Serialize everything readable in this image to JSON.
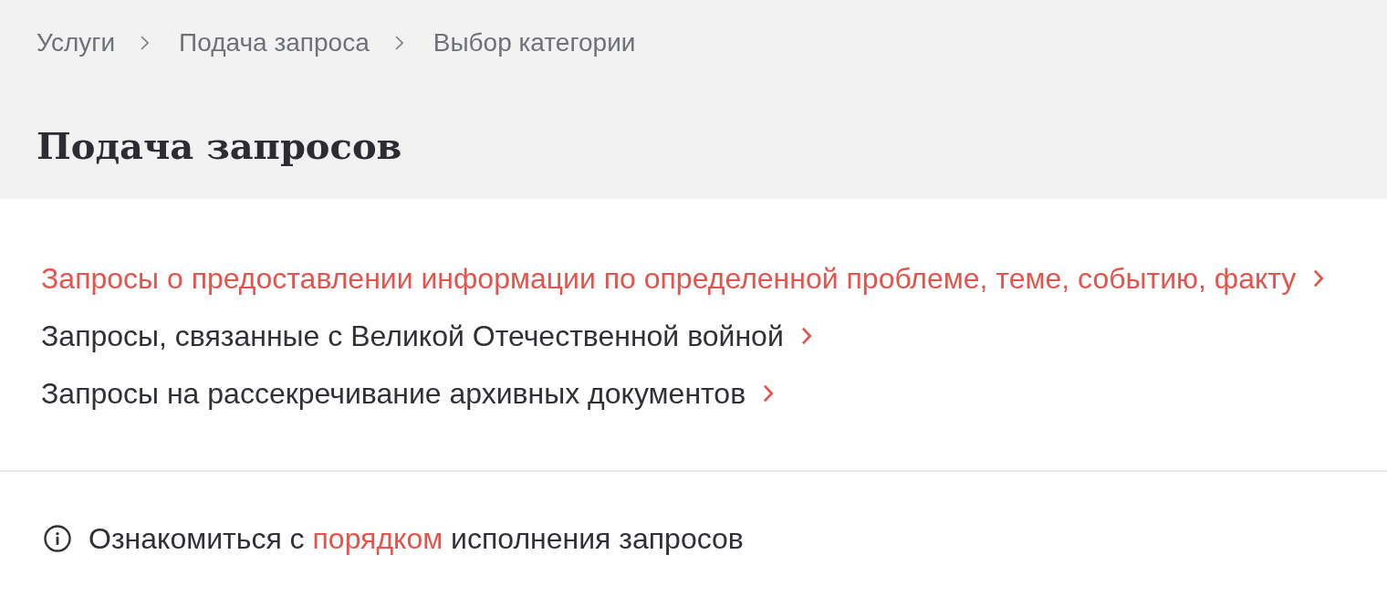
{
  "breadcrumbs": [
    {
      "label": "Услуги"
    },
    {
      "label": "Подача запроса"
    },
    {
      "label": "Выбор категории"
    }
  ],
  "title": "Подача запросов",
  "categories": [
    {
      "label": "Запросы о предоставлении информации по определенной проблеме, теме, событию, факту",
      "highlighted": true
    },
    {
      "label": "Запросы, связанные с Великой Отечественной войной",
      "highlighted": false
    },
    {
      "label": "Запросы на рассекречивание архивных документов",
      "highlighted": false
    }
  ],
  "info": {
    "text_before": "Ознакомиться с",
    "link": "порядком",
    "text_after": "исполнения запросов"
  }
}
